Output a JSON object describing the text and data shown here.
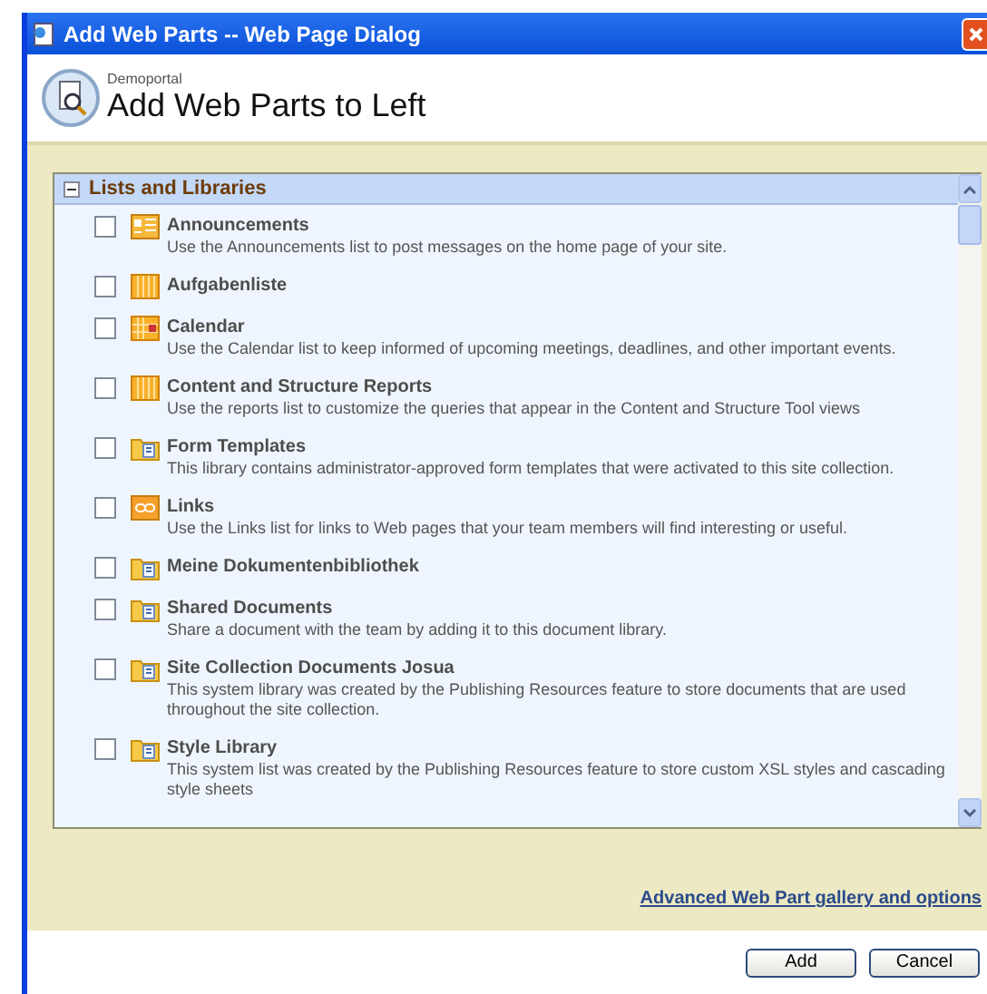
{
  "window": {
    "title": "Add Web Parts -- Web Page Dialog"
  },
  "header": {
    "site": "Demoportal",
    "title": "Add Web Parts to Left"
  },
  "section": {
    "title": "Lists and Libraries",
    "expanded": true,
    "items": [
      {
        "name": "Announcements",
        "kind": "announcements",
        "checked": false,
        "description": "Use the Announcements list to post messages on the home page of your site."
      },
      {
        "name": "Aufgabenliste",
        "kind": "list",
        "checked": false
      },
      {
        "name": "Calendar",
        "kind": "calendar",
        "checked": false,
        "description": "Use the Calendar list to keep informed of upcoming meetings, deadlines, and other important events."
      },
      {
        "name": "Content and Structure Reports",
        "kind": "list",
        "checked": false,
        "description": "Use the reports list to customize the queries that appear in the Content and Structure Tool views"
      },
      {
        "name": "Form Templates",
        "kind": "library",
        "checked": false,
        "description": "This library contains administrator-approved form templates that were activated to this site collection."
      },
      {
        "name": "Links",
        "kind": "links",
        "checked": false,
        "description": "Use the Links list for links to Web pages that your team members will find interesting or useful."
      },
      {
        "name": "Meine Dokumentenbibliothek",
        "kind": "library",
        "checked": false
      },
      {
        "name": "Shared Documents",
        "kind": "library",
        "checked": false,
        "description": "Share a document with the team by adding it to this document library."
      },
      {
        "name": "Site Collection Documents Josua",
        "kind": "library",
        "checked": false,
        "description": "This system library was created by the Publishing Resources feature to store documents that are used throughout the site collection."
      },
      {
        "name": "Style Library",
        "kind": "library",
        "checked": false,
        "description": "This system list was created by the Publishing Resources feature to store custom XSL styles and cascading style sheets"
      }
    ]
  },
  "advanced_link": "Advanced Web Part gallery and options",
  "buttons": [
    "Add",
    "Cancel"
  ]
}
